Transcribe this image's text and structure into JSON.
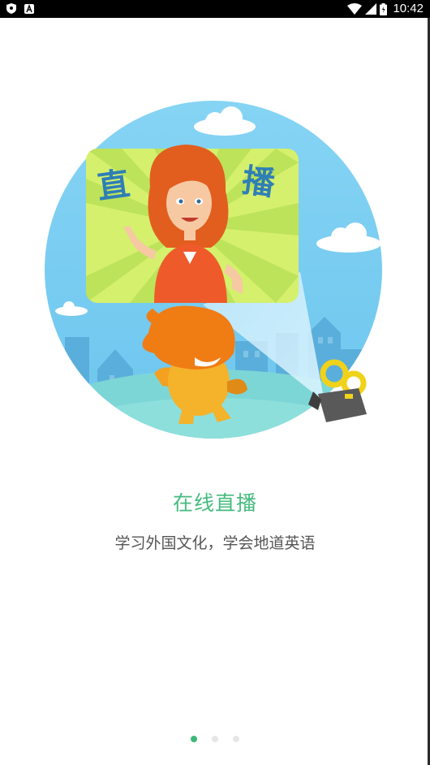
{
  "status_bar": {
    "time": "10:42",
    "left_icons": [
      "shield-icon",
      "app-notification-icon"
    ],
    "right_icons": [
      "wifi-icon",
      "cell-signal-icon",
      "battery-icon"
    ]
  },
  "slide": {
    "sign_text_left": "直",
    "sign_text_right": "播",
    "title": "在线直播",
    "subtitle": "学习外国文化，学会地道英语"
  },
  "pager": {
    "total": 3,
    "active_index": 0
  },
  "colors": {
    "accent": "#3cb878",
    "title": "#45bb7e",
    "subtitle": "#555555",
    "sky": "#7fd0f2"
  }
}
